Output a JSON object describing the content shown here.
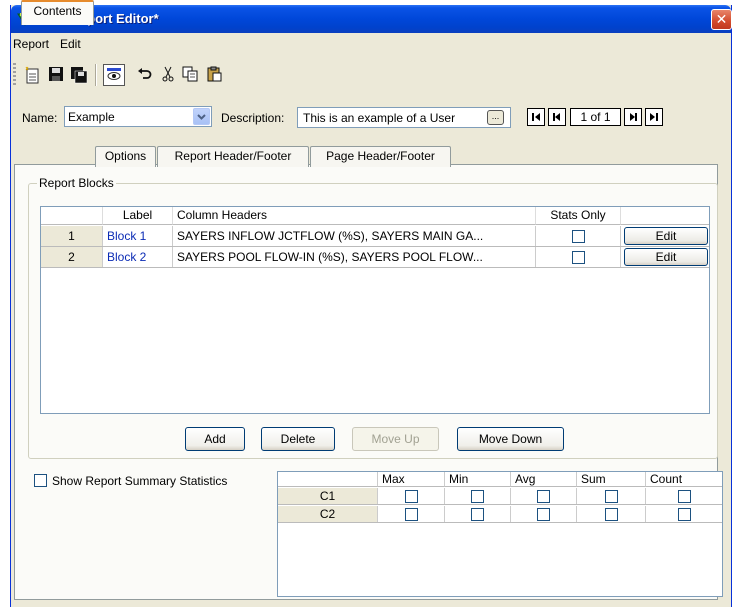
{
  "window": {
    "title": "User Report Editor*",
    "close_label": "✕"
  },
  "menu": [
    "Report",
    "Edit"
  ],
  "toolbar": {
    "icons": [
      "new-icon",
      "save-icon",
      "save-as-icon",
      "preview-icon",
      "undo-icon",
      "cut-icon",
      "copy-icon",
      "paste-icon"
    ]
  },
  "name_field": {
    "label": "Name:",
    "value": "Example"
  },
  "description_field": {
    "label": "Description:",
    "value": "This is an example of a User",
    "ellipsis": "..."
  },
  "pager": {
    "indicator": "1 of 1"
  },
  "tabs": [
    "Contents",
    "Options",
    "Report Header/Footer",
    "Page Header/Footer"
  ],
  "report_blocks": {
    "title": "Report Blocks",
    "columns": [
      "",
      "Label",
      "Column Headers",
      "Stats Only",
      ""
    ],
    "rows": [
      {
        "num": "1",
        "label": "Block 1",
        "headers": "SAYERS INFLOW JCTFLOW (%S), SAYERS MAIN GA...",
        "stats_only": false,
        "action": "Edit"
      },
      {
        "num": "2",
        "label": "Block 2",
        "headers": "SAYERS POOL FLOW-IN (%S), SAYERS POOL FLOW...",
        "stats_only": false,
        "action": "Edit"
      }
    ],
    "buttons": {
      "add": "Add",
      "delete": "Delete",
      "move_up": "Move Up",
      "move_down": "Move Down"
    }
  },
  "summary": {
    "checkbox_label": "Show Report Summary Statistics",
    "checked": false,
    "columns": [
      "",
      "Max",
      "Min",
      "Avg",
      "Sum",
      "Count"
    ],
    "rows": [
      {
        "label": "C1"
      },
      {
        "label": "C2"
      }
    ]
  },
  "colors": {
    "title_bar": "#0047d9",
    "window_bg": "#ece9d8",
    "active_tab_accent": "#e68b2c",
    "link_blue": "#0b2bb5"
  }
}
